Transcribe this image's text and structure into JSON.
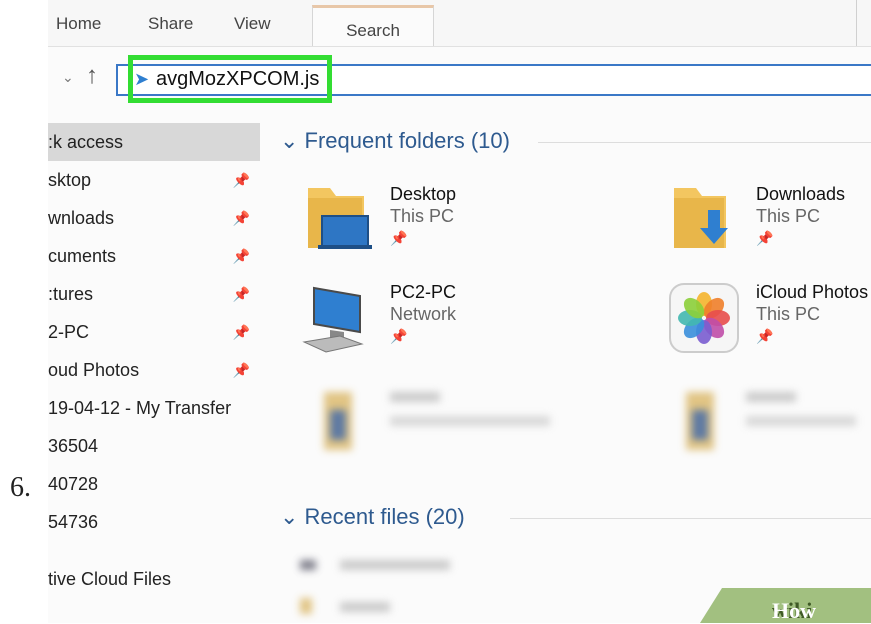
{
  "step_number": "6.",
  "ribbon": {
    "tabs": [
      "Home",
      "Share",
      "View"
    ],
    "active_tab": "Search"
  },
  "address": {
    "path": "avgMozXPCOM.js",
    "highlight_color": "#33dd33"
  },
  "nav": {
    "items": [
      {
        "label": ":k access",
        "pinned": false,
        "selected": true
      },
      {
        "label": "sktop",
        "pinned": true
      },
      {
        "label": "wnloads",
        "pinned": true
      },
      {
        "label": "cuments",
        "pinned": true
      },
      {
        "label": ":tures",
        "pinned": true
      },
      {
        "label": "2-PC",
        "pinned": true
      },
      {
        "label": "oud Photos",
        "pinned": true
      },
      {
        "label": "19-04-12 - My Transfer",
        "pinned": false
      },
      {
        "label": "36504",
        "pinned": false
      },
      {
        "label": "40728",
        "pinned": false
      },
      {
        "label": "54736",
        "pinned": false
      },
      {
        "label": "tive Cloud Files",
        "pinned": false
      }
    ]
  },
  "frequent_folders": {
    "header": "Frequent folders (10)",
    "items": [
      {
        "name": "Desktop",
        "location": "This PC",
        "icon": "desktop-folder-icon"
      },
      {
        "name": "Downloads",
        "location": "This PC",
        "icon": "downloads-folder-icon"
      },
      {
        "name": "PC2-PC",
        "location": "Network",
        "icon": "network-pc-icon"
      },
      {
        "name": "iCloud Photos",
        "location": "This PC",
        "icon": "icloud-photos-icon"
      }
    ]
  },
  "recent_files": {
    "header": "Recent files (20)"
  },
  "watermark": {
    "wiki": "wiki",
    "how": "How",
    "color": "#a2c080"
  }
}
